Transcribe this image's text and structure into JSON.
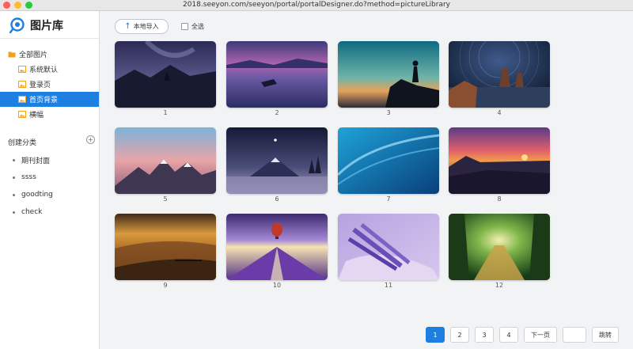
{
  "window": {
    "url": "2018.seeyon.com/seeyon/portal/portalDesigner.do?method=pictureLibrary"
  },
  "app": {
    "title": "图片库"
  },
  "tree": {
    "root": "全部图片",
    "children": [
      "系统默认",
      "登录页",
      "首页背景",
      "横幅"
    ],
    "active_index": 2
  },
  "categories": {
    "header": "创建分类",
    "items": [
      "期刊封面",
      "ssss",
      "goodting",
      "check"
    ]
  },
  "toolbar": {
    "import_label": "本地导入",
    "select_all_label": "全选"
  },
  "images": [
    "1",
    "2",
    "3",
    "4",
    "5",
    "6",
    "7",
    "8",
    "9",
    "10",
    "11",
    "12"
  ],
  "pager": {
    "pages": [
      "1",
      "2",
      "3",
      "4"
    ],
    "current": "1",
    "next_label": "下一页",
    "jump_label": "跳转"
  },
  "colors": {
    "accent": "#1e7fe3",
    "folder_icon": "#f0a21b"
  }
}
